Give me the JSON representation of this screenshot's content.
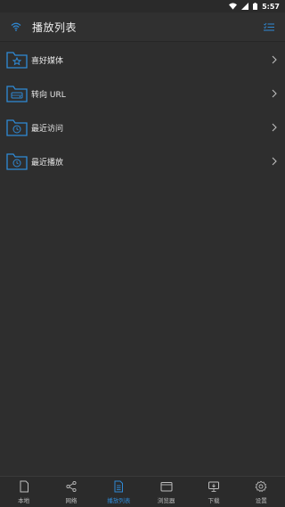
{
  "status": {
    "time": "5:57"
  },
  "app_bar": {
    "title": "播放列表"
  },
  "list": [
    {
      "label": "喜好媒体",
      "icon": "folder-star-icon"
    },
    {
      "label": "转向 URL",
      "icon": "folder-drive-icon"
    },
    {
      "label": "最近访问",
      "icon": "folder-clock-icon"
    },
    {
      "label": "最近播放",
      "icon": "folder-clock-icon"
    }
  ],
  "bottom_nav": [
    {
      "label": "本地",
      "icon": "file-icon"
    },
    {
      "label": "网络",
      "icon": "share-icon"
    },
    {
      "label": "播放列表",
      "icon": "playlist-icon",
      "active": true
    },
    {
      "label": "浏览器",
      "icon": "browser-icon"
    },
    {
      "label": "下载",
      "icon": "download-icon"
    },
    {
      "label": "设置",
      "icon": "gear-icon"
    }
  ],
  "colors": {
    "accent": "#2f8ad6",
    "background": "#2e2e2e"
  }
}
